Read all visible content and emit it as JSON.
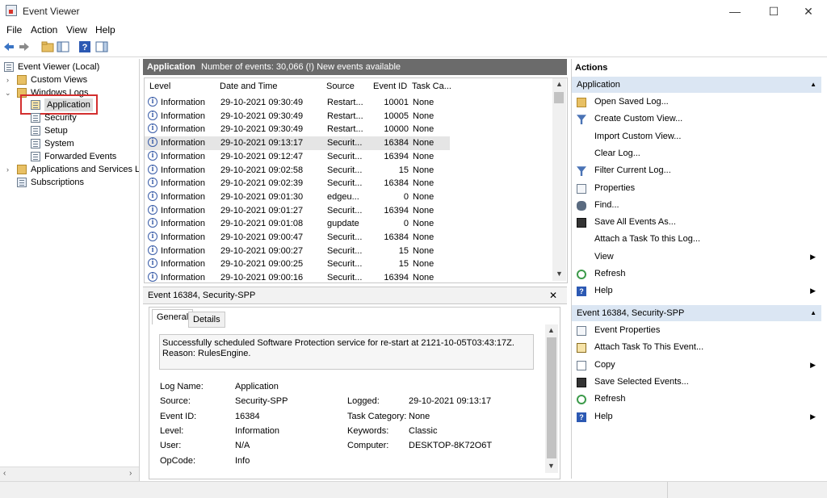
{
  "window": {
    "title": "Event Viewer",
    "controls": [
      "—",
      "☐",
      "✕"
    ]
  },
  "menu": [
    "File",
    "Action",
    "View",
    "Help"
  ],
  "tree": {
    "root": "Event Viewer (Local)",
    "custom_views": "Custom Views",
    "windows_logs": "Windows Logs",
    "logs": [
      "Application",
      "Security",
      "Setup",
      "System",
      "Forwarded Events"
    ],
    "apps_services": "Applications and Services Lo",
    "subscriptions": "Subscriptions"
  },
  "middle": {
    "log_name": "Application",
    "event_count": "Number of events: 30,066 (!) New events available",
    "columns": [
      "Level",
      "Date and Time",
      "Source",
      "Event ID",
      "Task Ca..."
    ],
    "rows": [
      [
        "Information",
        "29-10-2021 09:30:49",
        "Restart...",
        "10001",
        "None"
      ],
      [
        "Information",
        "29-10-2021 09:30:49",
        "Restart...",
        "10005",
        "None"
      ],
      [
        "Information",
        "29-10-2021 09:30:49",
        "Restart...",
        "10000",
        "None"
      ],
      [
        "Information",
        "29-10-2021 09:13:17",
        "Securit...",
        "16384",
        "None"
      ],
      [
        "Information",
        "29-10-2021 09:12:47",
        "Securit...",
        "16394",
        "None"
      ],
      [
        "Information",
        "29-10-2021 09:02:58",
        "Securit...",
        "15",
        "None"
      ],
      [
        "Information",
        "29-10-2021 09:02:39",
        "Securit...",
        "16384",
        "None"
      ],
      [
        "Information",
        "29-10-2021 09:01:30",
        "edgeu...",
        "0",
        "None"
      ],
      [
        "Information",
        "29-10-2021 09:01:27",
        "Securit...",
        "16394",
        "None"
      ],
      [
        "Information",
        "29-10-2021 09:01:08",
        "gupdate",
        "0",
        "None"
      ],
      [
        "Information",
        "29-10-2021 09:00:47",
        "Securit...",
        "16384",
        "None"
      ],
      [
        "Information",
        "29-10-2021 09:00:27",
        "Securit...",
        "15",
        "None"
      ],
      [
        "Information",
        "29-10-2021 09:00:25",
        "Securit...",
        "15",
        "None"
      ],
      [
        "Information",
        "29-10-2021 09:00:16",
        "Securit...",
        "16394",
        "None"
      ]
    ]
  },
  "detail": {
    "title": "Event 16384, Security-SPP",
    "close": "✕",
    "tabs": [
      "General",
      "Details"
    ],
    "message": "Successfully scheduled Software Protection service for re-start at 2121-10-05T03:43:17Z. Reason: RulesEngine.",
    "fields": {
      "log_name_label": "Log Name:",
      "log_name": "Application",
      "source_label": "Source:",
      "source": "Security-SPP",
      "logged_label": "Logged:",
      "logged": "29-10-2021 09:13:17",
      "event_id_label": "Event ID:",
      "event_id": "16384",
      "task_label": "Task Category:",
      "task": "None",
      "level_label": "Level:",
      "level": "Information",
      "keywords_label": "Keywords:",
      "keywords": "Classic",
      "user_label": "User:",
      "user": "N/A",
      "computer_label": "Computer:",
      "computer": "DESKTOP-8K72O6T",
      "opcode_label": "OpCode:",
      "opcode": "Info"
    }
  },
  "actions": {
    "title": "Actions",
    "section1": "Application",
    "items1": [
      "Open Saved Log...",
      "Create Custom View...",
      "Import Custom View...",
      "Clear Log...",
      "Filter Current Log...",
      "Properties",
      "Find...",
      "Save All Events As...",
      "Attach a Task To this Log...",
      "View",
      "Refresh",
      "Help"
    ],
    "section2": "Event 16384, Security-SPP",
    "items2": [
      "Event Properties",
      "Attach Task To This Event...",
      "Copy",
      "Save Selected Events...",
      "Refresh",
      "Help"
    ]
  },
  "colors": {
    "highlight": "#d32f2f",
    "section_bg": "#dbe6f3",
    "header_bg": "#6b6b6b",
    "selected_row": "#e5e5e5"
  }
}
